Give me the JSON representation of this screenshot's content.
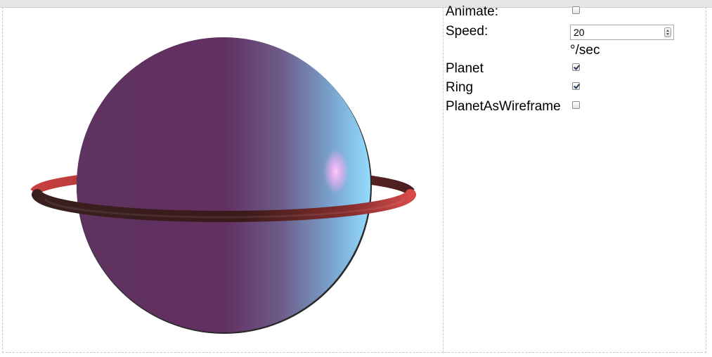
{
  "panel": {
    "animate": {
      "label": "Animate:",
      "checked": false
    },
    "speed": {
      "label": "Speed:",
      "value": "20",
      "unit": "°/sec"
    },
    "planet": {
      "label": "Planet",
      "checked": true
    },
    "ring": {
      "label": "Ring",
      "checked": true
    },
    "wireframe": {
      "label": "PlanetAsWireframe",
      "checked": false
    }
  },
  "scene": {
    "planet_colors": [
      "#5f3360",
      "#6d5d8a",
      "#8fcdf0",
      "#ffb8f3"
    ],
    "ring_colors": [
      "#d34a4a",
      "#3a1b1b"
    ]
  }
}
